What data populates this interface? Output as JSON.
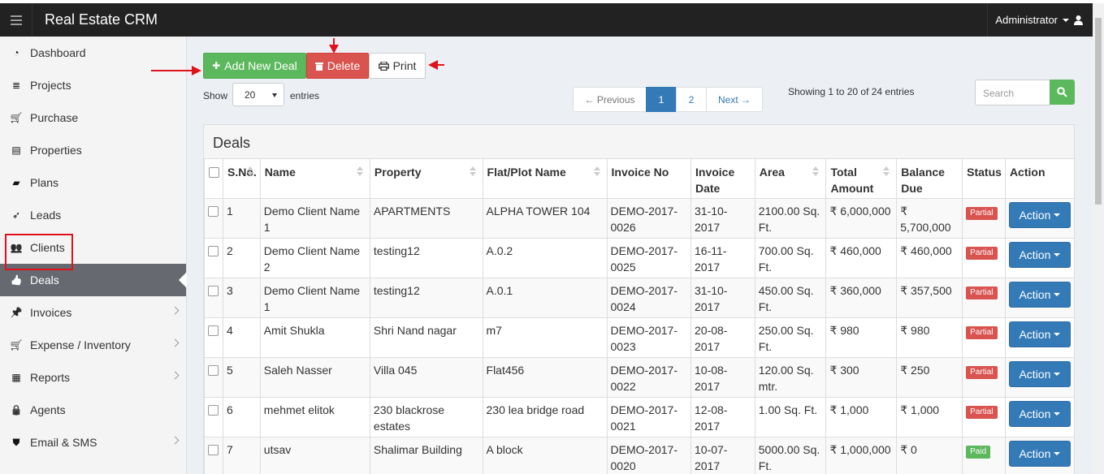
{
  "app": {
    "title": "Real Estate CRM",
    "user": "Administrator"
  },
  "sidebar": {
    "items": [
      {
        "label": "Dashboard",
        "icon": "dashboard-icon"
      },
      {
        "label": "Projects",
        "icon": "list-icon"
      },
      {
        "label": "Purchase",
        "icon": "cart-icon"
      },
      {
        "label": "Properties",
        "icon": "building-icon"
      },
      {
        "label": "Plans",
        "icon": "briefcase-icon"
      },
      {
        "label": "Leads",
        "icon": "rocket-icon"
      },
      {
        "label": "Clients",
        "icon": "users-icon"
      },
      {
        "label": "Deals",
        "icon": "thumbs-up-icon",
        "active": true
      },
      {
        "label": "Invoices",
        "icon": "pushpin-icon",
        "expandable": true
      },
      {
        "label": "Expense / Inventory",
        "icon": "cart-icon",
        "expandable": true
      },
      {
        "label": "Reports",
        "icon": "table-icon",
        "expandable": true
      },
      {
        "label": "Agents",
        "icon": "lock-icon"
      },
      {
        "label": "Email & SMS",
        "icon": "shield-icon",
        "expandable": true
      }
    ]
  },
  "toolbar": {
    "add_label": "Add New Deal",
    "delete_label": "Delete",
    "print_label": "Print"
  },
  "length": {
    "show_label": "Show",
    "value": "20",
    "entries_label": "entries"
  },
  "pagination": {
    "prev": "← Previous",
    "pages": [
      "1",
      "2"
    ],
    "current": "1",
    "next": "Next →"
  },
  "info": "Showing 1 to 20 of 24 entries",
  "search": {
    "placeholder": "Search"
  },
  "panel": {
    "title": "Deals"
  },
  "table": {
    "headers": [
      "S.No.",
      "Name",
      "Property",
      "Flat/Plot Name",
      "Invoice No",
      "Invoice Date",
      "Area",
      "Total Amount",
      "Balance Due",
      "Status",
      "Action"
    ],
    "rows": [
      {
        "sno": "1",
        "name": "Demo Client Name 1",
        "property": "APARTMENTS",
        "flat": "ALPHA TOWER 104",
        "invoice": "DEMO-2017-0026",
        "date": "31-10-2017",
        "area": "2100.00 Sq. Ft.",
        "total": "₹ 6,000,000",
        "balance": "₹ 5,700,000",
        "status": "Partial",
        "action": "Action"
      },
      {
        "sno": "2",
        "name": "Demo Client Name 2",
        "property": "testing12",
        "flat": "A.0.2",
        "invoice": "DEMO-2017-0025",
        "date": "16-11-2017",
        "area": "700.00 Sq. Ft.",
        "total": "₹ 460,000",
        "balance": "₹ 460,000",
        "status": "Partial",
        "action": "Action"
      },
      {
        "sno": "3",
        "name": "Demo Client Name 1",
        "property": "testing12",
        "flat": "A.0.1",
        "invoice": "DEMO-2017-0024",
        "date": "31-10-2017",
        "area": "450.00 Sq. Ft.",
        "total": "₹ 360,000",
        "balance": "₹ 357,500",
        "status": "Partial",
        "action": "Action"
      },
      {
        "sno": "4",
        "name": "Amit Shukla",
        "property": "Shri Nand nagar",
        "flat": "m7",
        "invoice": "DEMO-2017-0023",
        "date": "20-08-2017",
        "area": "250.00 Sq. Ft.",
        "total": "₹ 980",
        "balance": "₹ 980",
        "status": "Partial",
        "action": "Action"
      },
      {
        "sno": "5",
        "name": "Saleh Nasser",
        "property": "Villa 045",
        "flat": "Flat456",
        "invoice": "DEMO-2017-0022",
        "date": "10-08-2017",
        "area": "120.00 Sq. mtr.",
        "total": "₹ 300",
        "balance": "₹ 250",
        "status": "Partial",
        "action": "Action"
      },
      {
        "sno": "6",
        "name": "mehmet elitok",
        "property": "230 blackrose estates",
        "flat": "230 lea bridge road",
        "invoice": "DEMO-2017-0021",
        "date": "12-08-2017",
        "area": "1.00 Sq. Ft.",
        "total": "₹ 1,000",
        "balance": "₹ 1,000",
        "status": "Partial",
        "action": "Action"
      },
      {
        "sno": "7",
        "name": "utsav",
        "property": "Shalimar Building",
        "flat": "A block",
        "invoice": "DEMO-2017-0020",
        "date": "10-07-2017",
        "area": "5000.00 Sq. Ft.",
        "total": "₹ 1,000,000",
        "balance": "₹ 0",
        "status": "Paid",
        "action": "Action"
      }
    ]
  },
  "colors": {
    "success": "#5cb85c",
    "danger": "#d9534f",
    "primary": "#337ab7",
    "annotation": "#e0121b"
  }
}
